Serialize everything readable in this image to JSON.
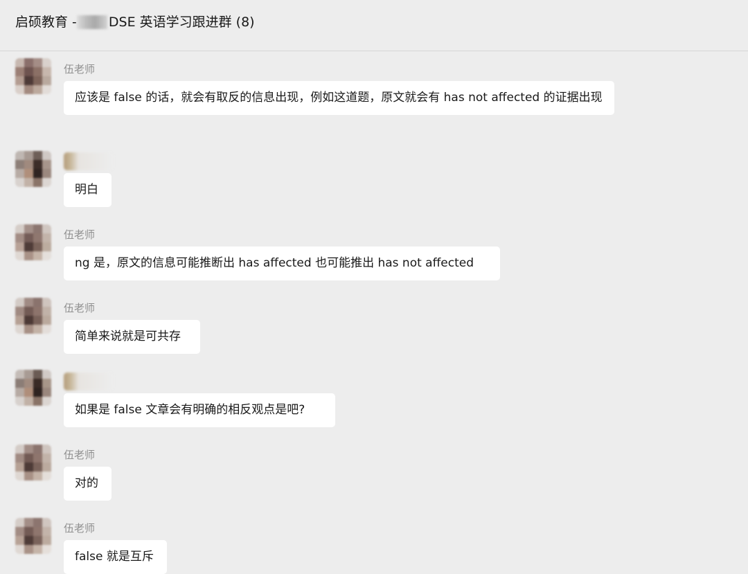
{
  "header": {
    "title_prefix": "启硕教育 - ",
    "title_suffix": "DSE 英语学习跟进群 (8)"
  },
  "messages": [
    {
      "sender": "伍老师",
      "text": "应该是 false 的话，就会有取反的信息出现，例如这道题，原文就会有 has not affected 的证据出现"
    },
    {
      "sender": "",
      "text": "明白"
    },
    {
      "sender": "伍老师",
      "text": "ng 是，原文的信息可能推断出 has affected 也可能推出 has not affected"
    },
    {
      "sender": "伍老师",
      "text": "简单来说就是可共存"
    },
    {
      "sender": "",
      "text": "如果是 false  文章会有明确的相反观点是吧?"
    },
    {
      "sender": "伍老师",
      "text": "对的"
    },
    {
      "sender": "伍老师",
      "text": "false 就是互斥"
    }
  ],
  "colors": {
    "background": "#ededed",
    "bubble": "#ffffff",
    "sender_text": "#8f8f8f",
    "divider": "#d6d6d6"
  }
}
